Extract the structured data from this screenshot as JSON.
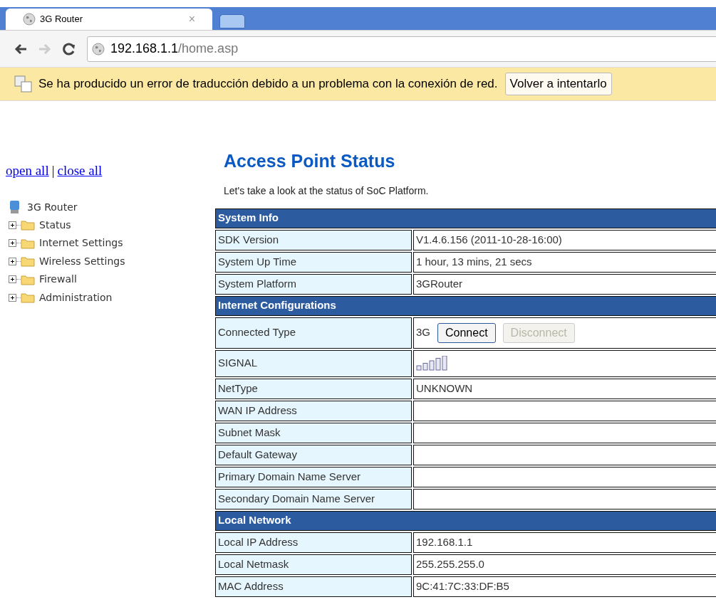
{
  "browser": {
    "tab": {
      "title": "3G Router",
      "close": "×"
    },
    "address": {
      "host": "192.168.1.1",
      "path": "/home.asp"
    },
    "infobar": {
      "message": "Se ha producido un error de traducción debido a un problema con la conexión de red.",
      "button": "Volver a intentarlo"
    }
  },
  "sidebar": {
    "links": [
      "open all",
      "close all"
    ],
    "separator": "|",
    "tree": {
      "root": "3G Router",
      "children": [
        {
          "label": "Status",
          "expanded": false
        },
        {
          "label": "Internet Settings",
          "expanded": false
        },
        {
          "label": "Wireless Settings",
          "expanded": false
        },
        {
          "label": "Firewall",
          "expanded": false
        },
        {
          "label": "Administration",
          "expanded": false
        }
      ]
    }
  },
  "page": {
    "title": "Access Point Status",
    "intro": "Let's take a look at the status of SoC Platform.",
    "rows": [
      {
        "kind": "section",
        "label": "System Info"
      },
      {
        "kind": "field",
        "label": "SDK Version",
        "value": "V1.4.6.156 (2011-10-28-16:00)"
      },
      {
        "kind": "field",
        "label": "System Up Time",
        "value": "1 hour, 13 mins, 21 secs"
      },
      {
        "kind": "field",
        "label": "System Platform",
        "value": "3GRouter"
      },
      {
        "kind": "section",
        "label": "Internet Configurations"
      },
      {
        "kind": "buttons",
        "label": "Connected Type",
        "value": "3G",
        "buttons": [
          {
            "label": "Connect",
            "disabled": false
          },
          {
            "label": "Disconnect",
            "disabled": true
          }
        ]
      },
      {
        "kind": "signal",
        "label": "SIGNAL"
      },
      {
        "kind": "field",
        "label": "NetType",
        "value": "UNKNOWN"
      },
      {
        "kind": "field",
        "label": "WAN IP Address"
      },
      {
        "kind": "field",
        "label": "Subnet Mask"
      },
      {
        "kind": "field",
        "label": "Default Gateway"
      },
      {
        "kind": "field",
        "label": "Primary Domain Name Server"
      },
      {
        "kind": "field",
        "label": "Secondary Domain Name Server"
      },
      {
        "kind": "section",
        "label": "Local Network"
      },
      {
        "kind": "field",
        "label": "Local IP Address",
        "value": "192.168.1.1"
      },
      {
        "kind": "field",
        "label": "Local Netmask",
        "value": "255.255.255.0"
      },
      {
        "kind": "field",
        "label": "MAC Address",
        "value": "9C:41:7C:33:DF:B5"
      }
    ]
  }
}
